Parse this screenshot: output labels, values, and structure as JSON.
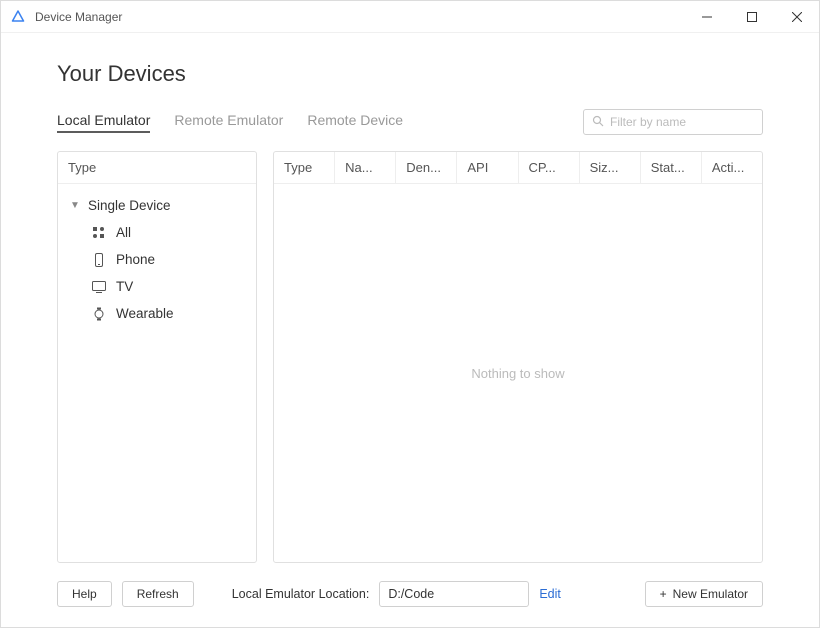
{
  "window": {
    "title": "Device Manager"
  },
  "page": {
    "title": "Your Devices"
  },
  "tabs": [
    {
      "label": "Local Emulator",
      "active": true
    },
    {
      "label": "Remote Emulator",
      "active": false
    },
    {
      "label": "Remote Device",
      "active": false
    }
  ],
  "search": {
    "placeholder": "Filter by name",
    "value": ""
  },
  "sidePanel": {
    "header": "Type",
    "tree": {
      "parent": "Single Device",
      "children": [
        {
          "icon": "grid-icon",
          "label": "All"
        },
        {
          "icon": "phone-icon",
          "label": "Phone"
        },
        {
          "icon": "tv-icon",
          "label": "TV"
        },
        {
          "icon": "watch-icon",
          "label": "Wearable"
        }
      ]
    }
  },
  "table": {
    "columns": [
      "Type",
      "Na...",
      "Den...",
      "API",
      "CP...",
      "Siz...",
      "Stat...",
      "Acti..."
    ],
    "emptyText": "Nothing to show"
  },
  "bottom": {
    "helpLabel": "Help",
    "refreshLabel": "Refresh",
    "locationLabel": "Local Emulator Location:",
    "locationValue": "D:/Code",
    "editLabel": "Edit",
    "newEmulatorLabel": "New Emulator"
  }
}
